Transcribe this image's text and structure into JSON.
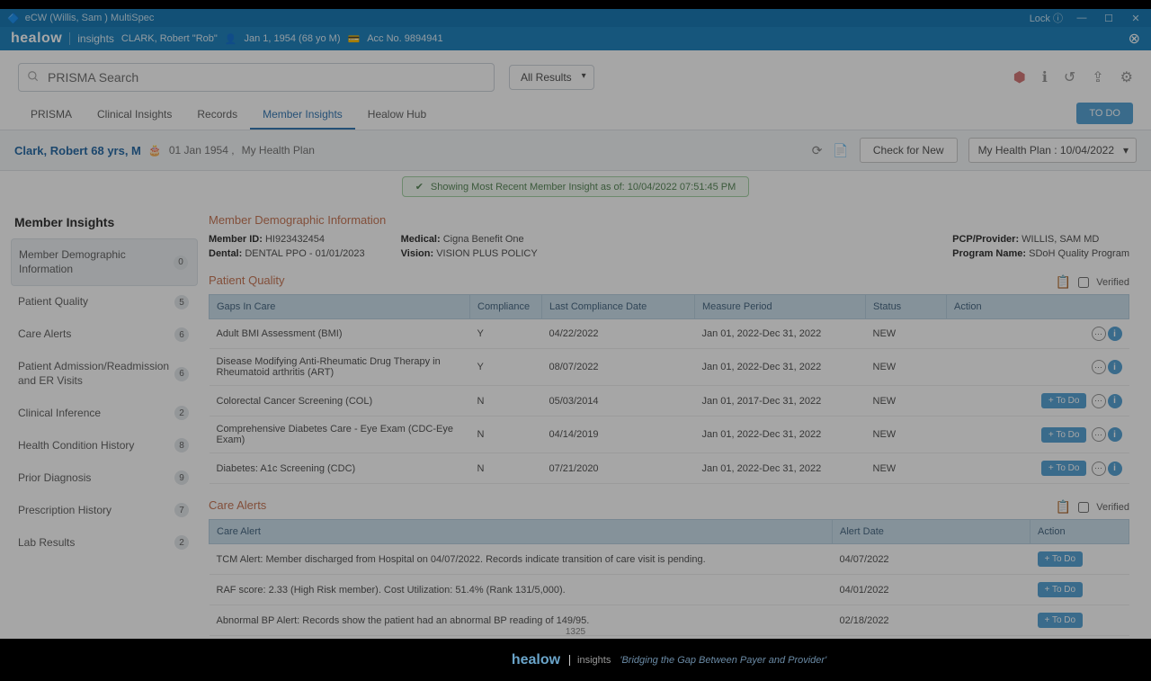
{
  "titlebar": {
    "title": "eCW (Willis, Sam ) MultiSpec",
    "lock": "Lock"
  },
  "appbar": {
    "brand": "healow",
    "brand_sub": "insights",
    "patient": "CLARK, Robert \"Rob\"",
    "dob": "Jan 1, 1954 (68 yo M)",
    "acc": "Acc No. 9894941"
  },
  "toolbar": {
    "search_placeholder": "PRISMA Search",
    "results": "All Results"
  },
  "tabs": {
    "items": [
      "PRISMA",
      "Clinical Insights",
      "Records",
      "Member Insights",
      "Healow Hub"
    ],
    "todo": "TO DO"
  },
  "patientbar": {
    "name": "Clark, Robert 68 yrs, M",
    "dob": "01 Jan 1954 ,",
    "plan_short": "My Health Plan",
    "check": "Check for New",
    "plan_dd": "My Health Plan : 10/04/2022"
  },
  "banner": "Showing Most Recent Member Insight as of: 10/04/2022 07:51:45 PM",
  "sidebar": {
    "title": "Member Insights",
    "items": [
      {
        "label": "Member Demographic Information",
        "badge": "0"
      },
      {
        "label": "Patient Quality",
        "badge": "5"
      },
      {
        "label": "Care Alerts",
        "badge": "6"
      },
      {
        "label": "Patient Admission/Readmission and ER Visits",
        "badge": "6"
      },
      {
        "label": "Clinical Inference",
        "badge": "2"
      },
      {
        "label": "Health Condition History",
        "badge": "8"
      },
      {
        "label": "Prior Diagnosis",
        "badge": "9"
      },
      {
        "label": "Prescription History",
        "badge": "7"
      },
      {
        "label": "Lab Results",
        "badge": "2"
      }
    ]
  },
  "demo": {
    "title": "Member Demographic Information",
    "member_id_l": "Member ID:",
    "member_id_v": "HI923432454",
    "dental_l": "Dental:",
    "dental_v": "DENTAL PPO - 01/01/2023",
    "medical_l": "Medical:",
    "medical_v": "Cigna Benefit One",
    "vision_l": "Vision:",
    "vision_v": "VISION PLUS POLICY",
    "pcp_l": "PCP/Provider:",
    "pcp_v": "WILLIS, SAM MD",
    "prog_l": "Program Name:",
    "prog_v": "SDoH Quality Program"
  },
  "quality": {
    "title": "Patient Quality",
    "verified": "Verified",
    "headers": [
      "Gaps In Care",
      "Compliance",
      "Last Compliance Date",
      "Measure Period",
      "Status",
      "Action"
    ],
    "rows": [
      {
        "gap": "Adult BMI Assessment (BMI)",
        "comp": "Y",
        "date": "04/22/2022",
        "period": "Jan 01, 2022-Dec 31, 2022",
        "status": "NEW",
        "todo": false
      },
      {
        "gap": "Disease Modifying Anti-Rheumatic Drug Therapy in Rheumatoid arthritis (ART)",
        "comp": "Y",
        "date": "08/07/2022",
        "period": "Jan 01, 2022-Dec 31, 2022",
        "status": "NEW",
        "todo": false
      },
      {
        "gap": "Colorectal Cancer Screening (COL)",
        "comp": "N",
        "date": "05/03/2014",
        "period": "Jan 01, 2017-Dec 31, 2022",
        "status": "NEW",
        "todo": true
      },
      {
        "gap": "Comprehensive Diabetes Care - Eye Exam (CDC-Eye Exam)",
        "comp": "N",
        "date": "04/14/2019",
        "period": "Jan 01, 2022-Dec 31, 2022",
        "status": "NEW",
        "todo": true
      },
      {
        "gap": "Diabetes: A1c Screening (CDC)",
        "comp": "N",
        "date": "07/21/2020",
        "period": "Jan 01, 2022-Dec 31, 2022",
        "status": "NEW",
        "todo": true
      }
    ],
    "todo_label": "+ To Do"
  },
  "alerts": {
    "title": "Care Alerts",
    "verified": "Verified",
    "headers": [
      "Care Alert",
      "Alert Date",
      "Action"
    ],
    "rows": [
      {
        "alert": "TCM Alert: Member discharged from Hospital on 04/07/2022. Records indicate transition of care visit is pending.",
        "date": "04/07/2022"
      },
      {
        "alert": "RAF score: 2.33 (High Risk member). Cost Utilization: 51.4% (Rank 131/5,000).",
        "date": "04/01/2022"
      },
      {
        "alert": "Abnormal BP Alert: Records show the patient had an abnormal BP reading of 149/95.",
        "date": "02/18/2022"
      }
    ],
    "todo_label": "+ To Do"
  },
  "footer": {
    "brand": "healow",
    "brand_sub": "insights",
    "tag": "'Bridging the Gap Between Payer and Provider'"
  },
  "time": "1325"
}
